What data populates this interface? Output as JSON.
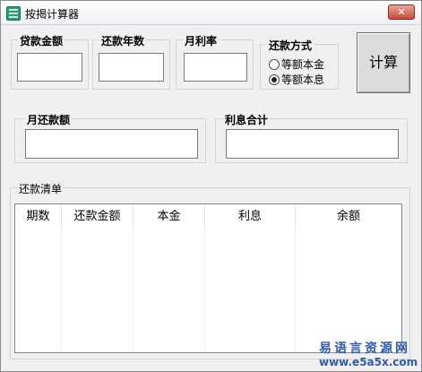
{
  "window": {
    "title": "按揭计算器",
    "close_label": "✕",
    "icon": "calculator-app-icon"
  },
  "inputs": {
    "loan_amount": {
      "label": "贷款金额",
      "value": ""
    },
    "loan_years": {
      "label": "还款年数",
      "value": ""
    },
    "monthly_rate": {
      "label": "月利率",
      "value": ""
    }
  },
  "repayment_method": {
    "label": "还款方式",
    "options": [
      {
        "label": "等额本金",
        "selected": false
      },
      {
        "label": "等额本息",
        "selected": true
      }
    ]
  },
  "calculate_button": {
    "label": "计算"
  },
  "outputs": {
    "monthly_payment": {
      "label": "月还款额",
      "value": ""
    },
    "total_interest": {
      "label": "利息合计",
      "value": ""
    }
  },
  "schedule": {
    "label": "还款清单",
    "columns": [
      "期数",
      "还款金额",
      "本金",
      "利息",
      "余额"
    ],
    "rows": []
  },
  "watermark": {
    "text": "易语言资源网",
    "url": "www.e5a5x.com"
  }
}
